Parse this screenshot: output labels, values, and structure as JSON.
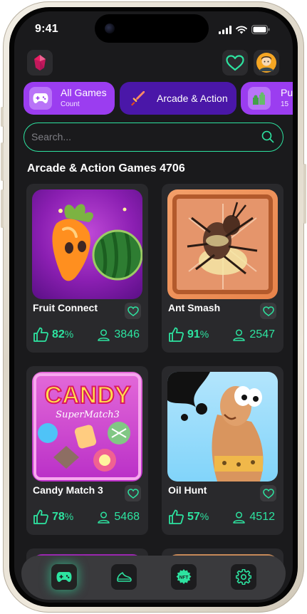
{
  "status_bar": {
    "time": "9:41"
  },
  "categories": [
    {
      "title": "All Games",
      "subtitle": "Count",
      "icon": "gamepad-icon"
    },
    {
      "title": "Arcade & Action",
      "icon": "sword-icon"
    },
    {
      "title": "Pu",
      "subtitle": "15",
      "icon": "puzzle-icon"
    }
  ],
  "search": {
    "placeholder": "Search..."
  },
  "section": {
    "title": "Arcade & Action Games 4706"
  },
  "games": [
    {
      "title": "Fruit Connect",
      "rating": "82",
      "rating_unit": "%",
      "players": "3846"
    },
    {
      "title": "Ant Smash",
      "rating": "91",
      "rating_unit": "%",
      "players": "2547"
    },
    {
      "title": "Candy Match 3",
      "rating": "78",
      "rating_unit": "%",
      "players": "5468"
    },
    {
      "title": "Oil Hunt",
      "rating": "57",
      "rating_unit": "%",
      "players": "4512"
    }
  ],
  "thumb_text": {
    "candy_word": "CANDY",
    "candy_sub": "SuperMatch3"
  },
  "colors": {
    "accent": "#2de3a0",
    "chip_purple": "#9b3df0",
    "chip_active": "#4a17a8",
    "background": "#1a1a1c",
    "card": "#29292c"
  },
  "nav": [
    {
      "name": "nav-games",
      "icon": "gamepad-icon",
      "active": true
    },
    {
      "name": "nav-running",
      "icon": "sneaker-icon",
      "active": false
    },
    {
      "name": "nav-nft",
      "icon": "nft-icon",
      "active": false
    },
    {
      "name": "nav-settings",
      "icon": "gear-icon",
      "active": false
    }
  ]
}
